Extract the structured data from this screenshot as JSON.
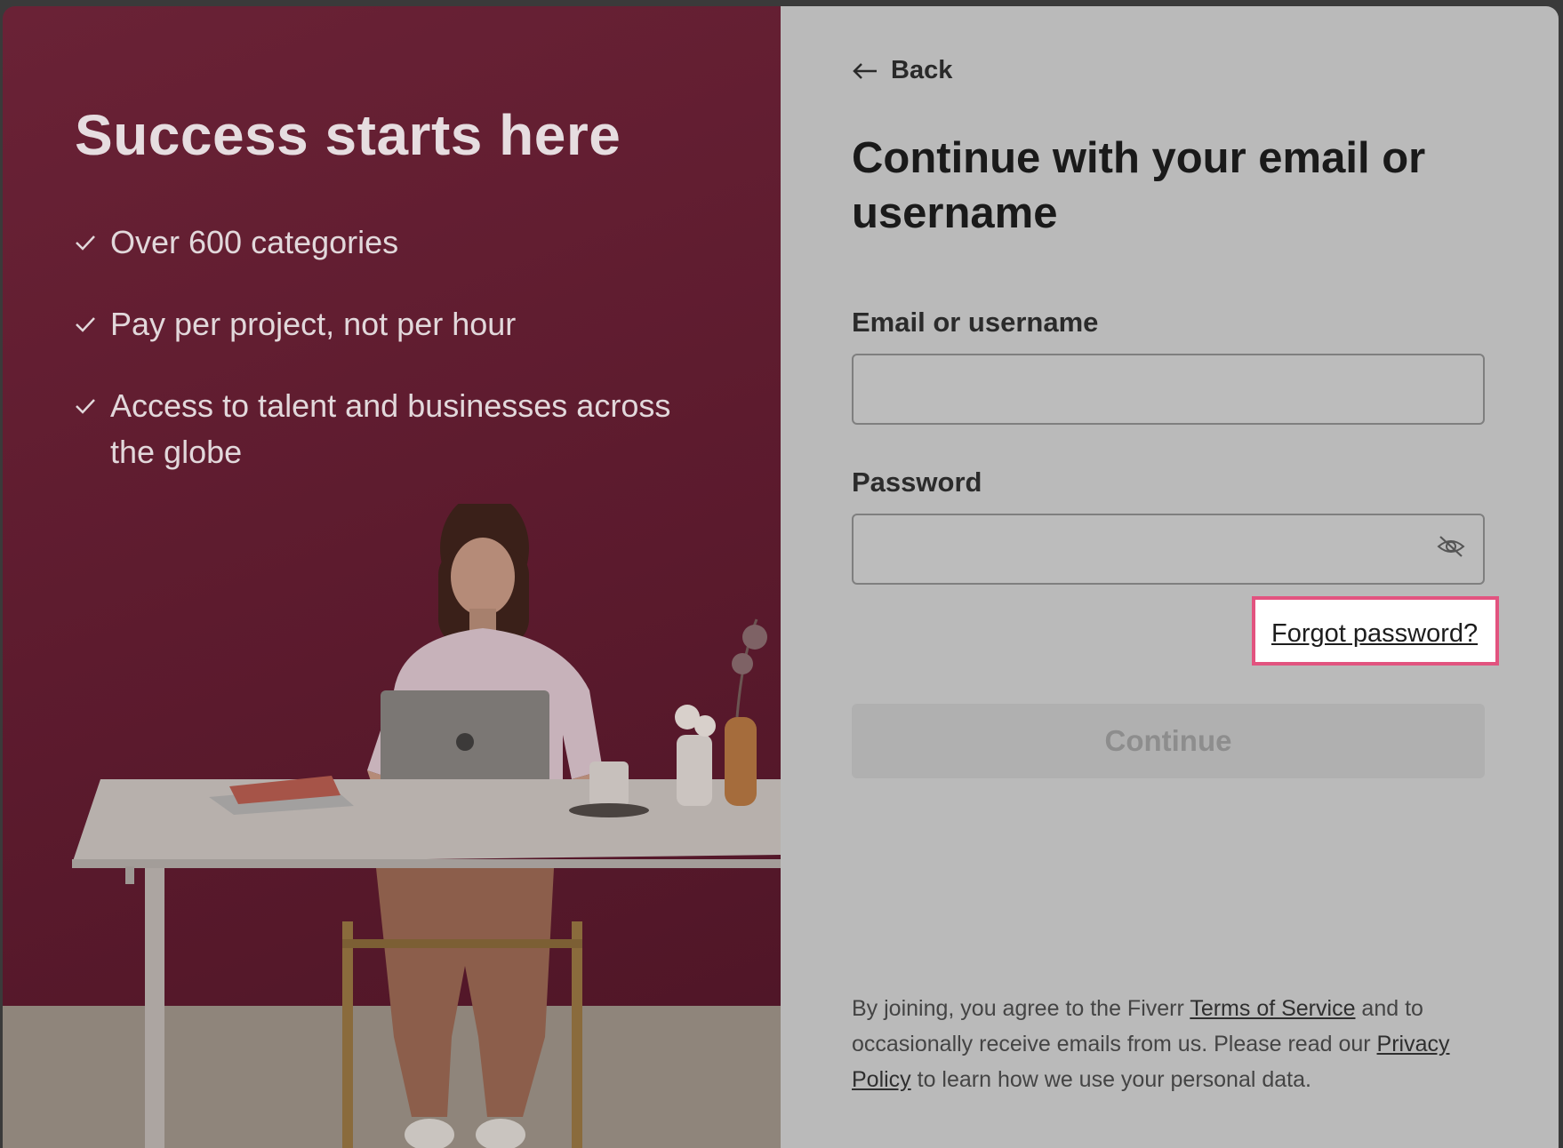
{
  "left": {
    "headline": "Success starts here",
    "features": [
      {
        "text": "Over 600 categories"
      },
      {
        "text": "Pay per project, not per hour"
      },
      {
        "text": "Access to talent and businesses across the globe"
      }
    ]
  },
  "right": {
    "back_label": "Back",
    "title": "Continue with your email or username",
    "email_label": "Email or username",
    "email_value": "",
    "password_label": "Password",
    "password_value": "",
    "forgot_label": "Forgot password?",
    "continue_label": "Continue",
    "legal": {
      "part1": "By joining, you agree to the Fiverr ",
      "terms_link": "Terms of Service",
      "part2": " and to occasionally receive emails from us. Please read our ",
      "privacy_link": "Privacy Policy",
      "part3": " to learn how we use your personal data."
    }
  },
  "colors": {
    "left_bg": "#5b1a2d",
    "right_bg": "#bababa",
    "highlight": "#e2537f"
  },
  "icons": {
    "back": "arrow-left-icon",
    "check": "check-icon",
    "password_toggle": "eye-off-icon"
  }
}
